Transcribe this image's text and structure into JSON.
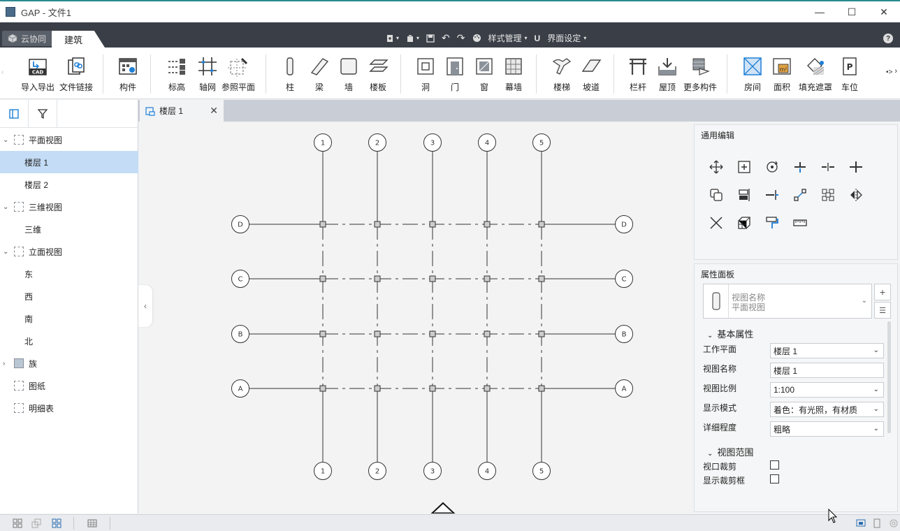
{
  "window": {
    "title": "GAP - 文件1",
    "minimize": "—",
    "maximize": "☐",
    "close": "✕"
  },
  "tabs": {
    "cloud": "云协同",
    "arch": "建筑"
  },
  "quick": {
    "style_mgr": "样式管理",
    "ui_settings": "界面设定",
    "help": "?"
  },
  "ribbon": [
    {
      "label": "导入导出",
      "icon": "cad-import-icon"
    },
    {
      "label": "文件链接",
      "icon": "file-link-icon"
    },
    {
      "label": "构件",
      "icon": "component-icon"
    },
    {
      "label": "标高",
      "icon": "level-icon"
    },
    {
      "label": "轴网",
      "icon": "grid-icon"
    },
    {
      "label": "参照平面",
      "icon": "ref-plane-icon"
    },
    {
      "label": "柱",
      "icon": "column-icon"
    },
    {
      "label": "梁",
      "icon": "beam-icon"
    },
    {
      "label": "墙",
      "icon": "wall-icon"
    },
    {
      "label": "楼板",
      "icon": "floor-icon"
    },
    {
      "label": "洞",
      "icon": "opening-icon"
    },
    {
      "label": "门",
      "icon": "door-icon"
    },
    {
      "label": "窗",
      "icon": "window-icon"
    },
    {
      "label": "幕墙",
      "icon": "curtain-wall-icon"
    },
    {
      "label": "楼梯",
      "icon": "stair-icon"
    },
    {
      "label": "坡道",
      "icon": "ramp-icon"
    },
    {
      "label": "栏杆",
      "icon": "railing-icon"
    },
    {
      "label": "屋顶",
      "icon": "roof-icon"
    },
    {
      "label": "更多构件",
      "icon": "more-components-icon"
    },
    {
      "label": "房间",
      "icon": "room-icon"
    },
    {
      "label": "面积",
      "icon": "area-icon"
    },
    {
      "label": "填充遮罩",
      "icon": "fill-mask-icon"
    },
    {
      "label": "车位",
      "icon": "parking-icon"
    }
  ],
  "tree": {
    "plan_views": "平面视图",
    "floor1": "楼层 1",
    "floor2": "楼层 2",
    "views_3d": "三维视图",
    "view_3d": "三维",
    "elevations": "立面视图",
    "east": "东",
    "west": "西",
    "south": "南",
    "north": "北",
    "families": "族",
    "sheets": "图纸",
    "schedules": "明细表"
  },
  "doc_tab": {
    "label": "楼层 1",
    "close": "✕"
  },
  "grid": {
    "vertical_labels": [
      "1",
      "2",
      "3",
      "4",
      "5"
    ],
    "horizontal_labels": [
      "D",
      "C",
      "B",
      "A"
    ]
  },
  "edit_panel": {
    "title": "通用编辑"
  },
  "props": {
    "title": "属性面板",
    "type_line1": "视图名称",
    "type_line2": "平面视图",
    "section_basic": "基本属性",
    "work_plane_label": "工作平面",
    "work_plane": "楼层 1",
    "view_name_label": "视图名称",
    "view_name": "楼层 1",
    "scale_label": "视图比例",
    "scale": "1:100",
    "display_label": "显示模式",
    "display": "着色：有光照，有材质",
    "detail_label": "详细程度",
    "detail": "粗略",
    "section_range": "视图范围",
    "crop_label": "视口裁剪",
    "show_crop_label": "显示裁剪框"
  }
}
